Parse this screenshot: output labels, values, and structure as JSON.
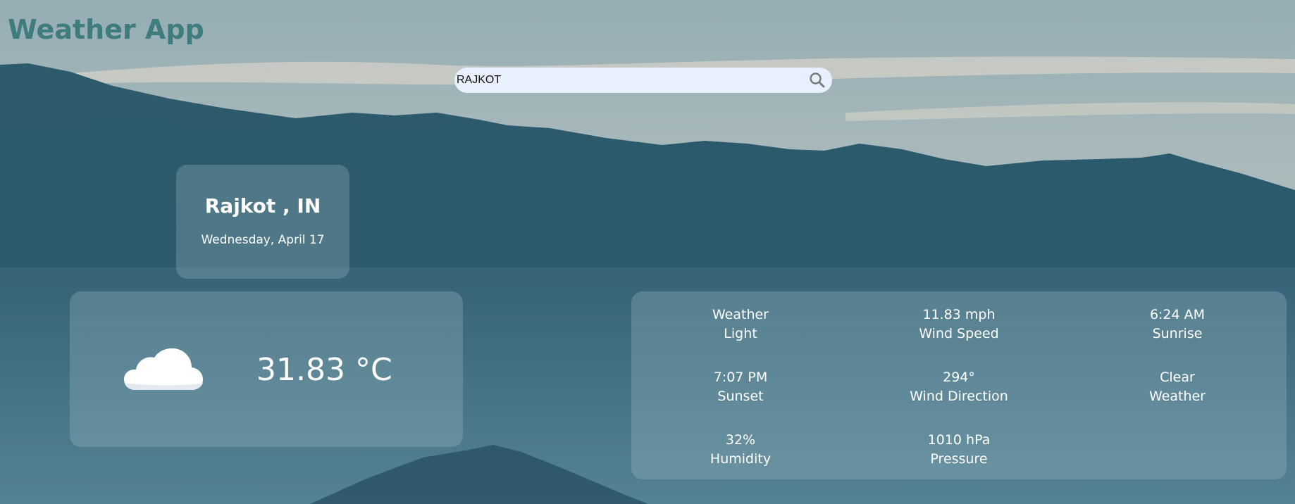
{
  "header": {
    "title": "Weather App"
  },
  "search": {
    "value": "RAJKOT",
    "icon": "search-icon"
  },
  "location": {
    "city": "Rajkot , IN",
    "date": "Wednesday, April 17"
  },
  "current": {
    "icon": "cloud-icon",
    "temperature": "31.83 °C"
  },
  "details": [
    {
      "value": "Weather",
      "label": "Light"
    },
    {
      "value": "11.83 mph",
      "label": "Wind Speed"
    },
    {
      "value": "6:24 AM",
      "label": "Sunrise"
    },
    {
      "value": "7:07 PM",
      "label": "Sunset"
    },
    {
      "value": "294°",
      "label": "Wind Direction"
    },
    {
      "value": "Clear",
      "label": "Weather"
    },
    {
      "value": "32%",
      "label": "Humidity"
    },
    {
      "value": "1010 hPa",
      "label": "Pressure"
    }
  ],
  "colors": {
    "title": "#3e7c7e",
    "search_bg": "#e8f0fe",
    "text": "#ffffff"
  }
}
